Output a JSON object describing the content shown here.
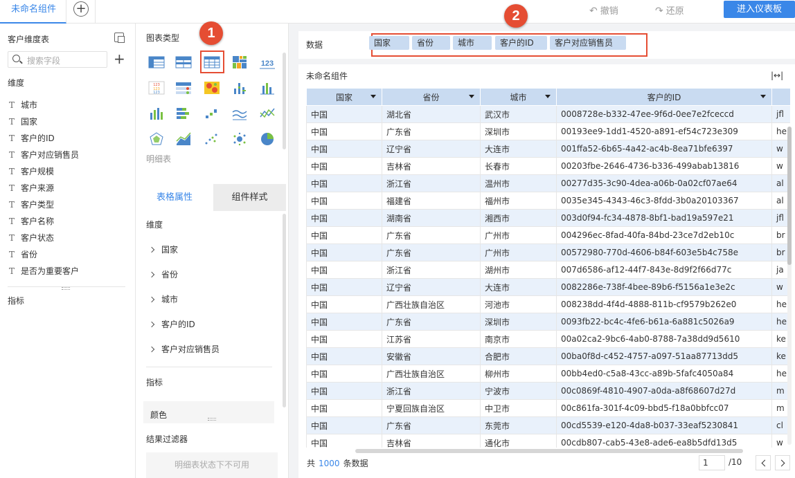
{
  "topbar": {
    "active_tab": "未命名组件",
    "add_tab": "+",
    "undo": "撤销",
    "redo": "还原",
    "enter_dashboard": "进入仪表板"
  },
  "markers": {
    "one": "1",
    "two": "2"
  },
  "left_panel": {
    "title": "客户维度表",
    "search_placeholder": "搜索字段",
    "dimension_label": "维度",
    "fields": [
      "城市",
      "国家",
      "客户的ID",
      "客户对应销售员",
      "客户规模",
      "客户来源",
      "客户类型",
      "客户名称",
      "客户状态",
      "省份",
      "是否为重要客户"
    ],
    "metric_label": "指标"
  },
  "mid_panel": {
    "chart_type_label": "图表类型",
    "selected_caption": "明细表",
    "tabs": [
      "表格属性",
      "组件样式"
    ],
    "dimension_label": "维度",
    "dimensions": [
      "国家",
      "省份",
      "城市",
      "客户的ID",
      "客户对应销售员"
    ],
    "metric_label": "指标",
    "color_label": "颜色",
    "filter_label": "结果过滤器",
    "filter_disabled": "明细表状态下不可用"
  },
  "right_panel": {
    "data_label": "数据",
    "pills": [
      "国家",
      "省份",
      "城市",
      "客户的ID",
      "客户对应销售员"
    ],
    "widget_title": "未命名组件",
    "expand_icon": "|↔|",
    "columns": [
      "国家",
      "省份",
      "城市",
      "客户的ID"
    ],
    "rows": [
      [
        "中国",
        "湖北省",
        "武汉市",
        "0008728e-b332-47ee-9f6d-0ee7e2fceccd",
        "jfl"
      ],
      [
        "中国",
        "广东省",
        "深圳市",
        "00193ee9-1dd1-4520-a891-ef54c723e309",
        "he"
      ],
      [
        "中国",
        "辽宁省",
        "大连市",
        "001ffa52-6b65-4a42-ac4b-8ea71bfe6397",
        "w"
      ],
      [
        "中国",
        "吉林省",
        "长春市",
        "00203fbe-2646-4736-b336-499abab13816",
        "w"
      ],
      [
        "中国",
        "浙江省",
        "温州市",
        "00277d35-3c90-4dea-a06b-0a02cf07ae64",
        "al"
      ],
      [
        "中国",
        "福建省",
        "福州市",
        "0035e345-4343-46c3-8fdd-3b0a20103367",
        "al"
      ],
      [
        "中国",
        "湖南省",
        "湘西市",
        "003d0f94-fc34-4878-8bf1-bad19a597e21",
        "jfl"
      ],
      [
        "中国",
        "广东省",
        "广州市",
        "004296ec-8fad-40fa-84bd-23ce7d2eb10c",
        "br"
      ],
      [
        "中国",
        "广东省",
        "广州市",
        "00572980-770d-4606-b84f-603e5b4c758e",
        "br"
      ],
      [
        "中国",
        "浙江省",
        "湖州市",
        "007d6586-af12-44f7-843e-8d9f2f66d77c",
        "ja"
      ],
      [
        "中国",
        "辽宁省",
        "大连市",
        "0082286e-738f-4bee-89b6-f5156a1e3e2c",
        "w"
      ],
      [
        "中国",
        "广西壮族自治区",
        "河池市",
        "008238dd-4f4d-4888-811b-cf9579b262e0",
        "he"
      ],
      [
        "中国",
        "广东省",
        "深圳市",
        "0093fb22-bc4c-4fe6-b61a-6a881c5026a9",
        "he"
      ],
      [
        "中国",
        "江苏省",
        "南京市",
        "00a02ca2-9bc6-4ab0-8788-7a38dd9d5610",
        "ke"
      ],
      [
        "中国",
        "安徽省",
        "合肥市",
        "00ba0f8d-c452-4757-a097-51aa87713dd5",
        "ke"
      ],
      [
        "中国",
        "广西壮族自治区",
        "柳州市",
        "00bb4ed0-c5a8-43cc-a89b-5fafc4050a84",
        "he"
      ],
      [
        "中国",
        "浙江省",
        "宁波市",
        "00c0869f-4810-4907-a0da-a8f68607d27d",
        "m"
      ],
      [
        "中国",
        "宁夏回族自治区",
        "中卫市",
        "00c861fa-301f-4c09-bbd5-f18a0bbfcc07",
        "m"
      ],
      [
        "中国",
        "广东省",
        "东莞市",
        "00cd5539-e120-4da8-b037-33eaf5230841",
        "cl"
      ],
      [
        "中国",
        "吉林省",
        "通化市",
        "00cdb807-cab5-43e8-ade6-ea8b5dfd13d5",
        "w"
      ]
    ],
    "footer_prefix": "共",
    "total": "1000",
    "footer_suffix": "条数据",
    "page_value": "1",
    "page_total": "/10"
  },
  "colors": {
    "accent": "#3a87e8",
    "marker": "#e54d33",
    "header_fill": "#c9dbf1",
    "row_stripe": "#e9f1fb"
  }
}
